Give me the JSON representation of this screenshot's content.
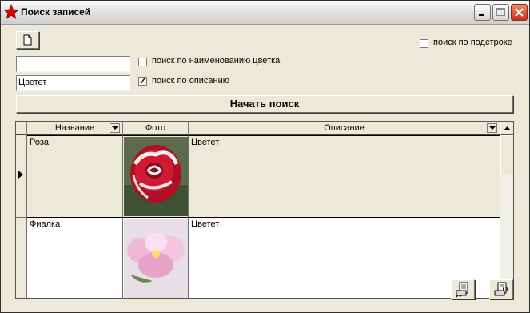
{
  "window": {
    "title": "Поиск записей"
  },
  "toolbar": {
    "new_icon": "new-document-icon"
  },
  "search": {
    "name_value": "",
    "description_value": "Цветет",
    "by_name_label": "поиск по наименованию цветка",
    "by_name_checked": false,
    "by_description_label": "поиск по описанию",
    "by_description_checked": true,
    "substring_label": "поиск по подстроке",
    "substring_checked": false,
    "start_button": "Начать поиск"
  },
  "grid": {
    "columns": [
      "Название",
      "Фото",
      "Описание"
    ],
    "rows": [
      {
        "name": "Роза",
        "photo": "red-rose-photo",
        "description": "Цветет",
        "selected": true
      },
      {
        "name": "Фиалка",
        "photo": "pink-violet-photo",
        "description": "Цветет",
        "selected": false
      }
    ]
  },
  "footer": {
    "icons": [
      "print-report-icon",
      "print-preview-icon"
    ]
  },
  "colors": {
    "title_star": "#e00000",
    "close_button": "#c8301c",
    "dialog_bg": "#ece9d8"
  }
}
